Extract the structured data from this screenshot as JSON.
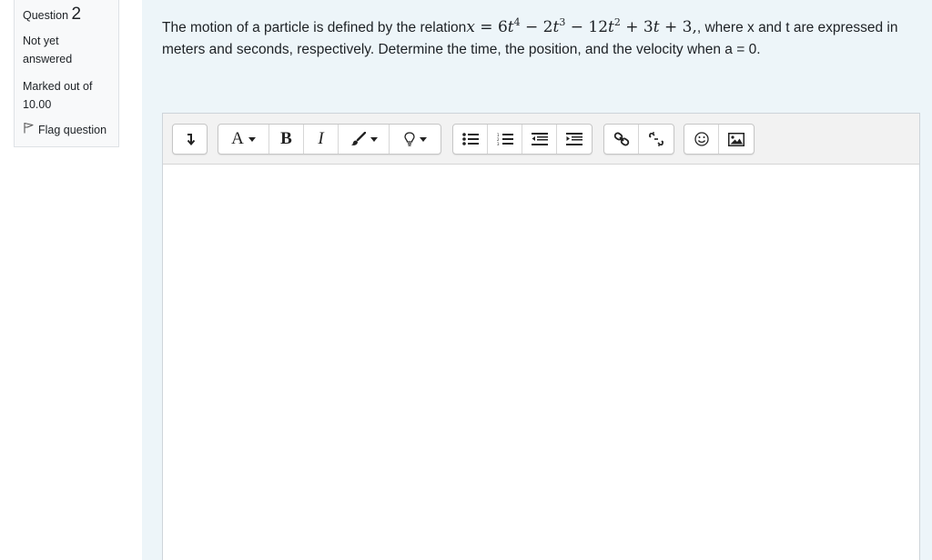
{
  "info": {
    "question_label": "Question",
    "question_number": "2",
    "state": "Not yet answered",
    "grade": "Marked out of 10.00",
    "flag_label": "Flag question"
  },
  "question": {
    "text_before": "The motion of a particle is defined by the relation",
    "equation": "x = 6t⁴ − 2t³ − 12t² + 3t + 3,",
    "text_after": ", where x and t are expressed in meters and seconds, respectively. Determine the time, the position, and the velocity when a = 0."
  },
  "toolbar": {
    "buttons": [
      {
        "icon": "collapse-toolbar-icon"
      },
      {
        "icon": "font-style-dropdown-icon",
        "label": "A"
      },
      {
        "icon": "bold-icon",
        "label": "B"
      },
      {
        "icon": "italic-icon",
        "label": "I"
      },
      {
        "icon": "font-color-brush-icon"
      },
      {
        "icon": "highlight-bulb-icon"
      },
      {
        "icon": "unordered-list-icon"
      },
      {
        "icon": "ordered-list-icon"
      },
      {
        "icon": "outdent-icon"
      },
      {
        "icon": "indent-icon"
      },
      {
        "icon": "link-icon"
      },
      {
        "icon": "unlink-icon"
      },
      {
        "icon": "emoji-icon"
      },
      {
        "icon": "image-icon"
      }
    ]
  },
  "editor": {
    "value": ""
  }
}
